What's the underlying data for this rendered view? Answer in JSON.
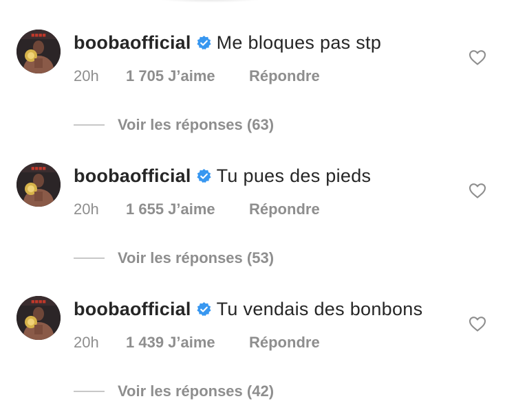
{
  "colors": {
    "primary_text": "#262626",
    "secondary_text": "#8e8e8e",
    "verified_blue": "#3897f0",
    "divider": "#c7c7c7"
  },
  "icons": {
    "verified": "verified-badge-icon",
    "like": "heart-outline-icon"
  },
  "comments": [
    {
      "username": "boobaofficial",
      "text": "Me bloques pas stp",
      "time": "20h",
      "likes": "1 705 J’aime",
      "reply": "Répondre",
      "view_replies": "Voir les réponses (63)"
    },
    {
      "username": "boobaofficial",
      "text": "Tu pues des pieds",
      "time": "20h",
      "likes": "1 655 J’aime",
      "reply": "Répondre",
      "view_replies": "Voir les réponses (53)"
    },
    {
      "username": "boobaofficial",
      "text": "Tu vendais des bonbons",
      "time": "20h",
      "likes": "1 439 J’aime",
      "reply": "Répondre",
      "view_replies": "Voir les réponses (42)"
    }
  ]
}
